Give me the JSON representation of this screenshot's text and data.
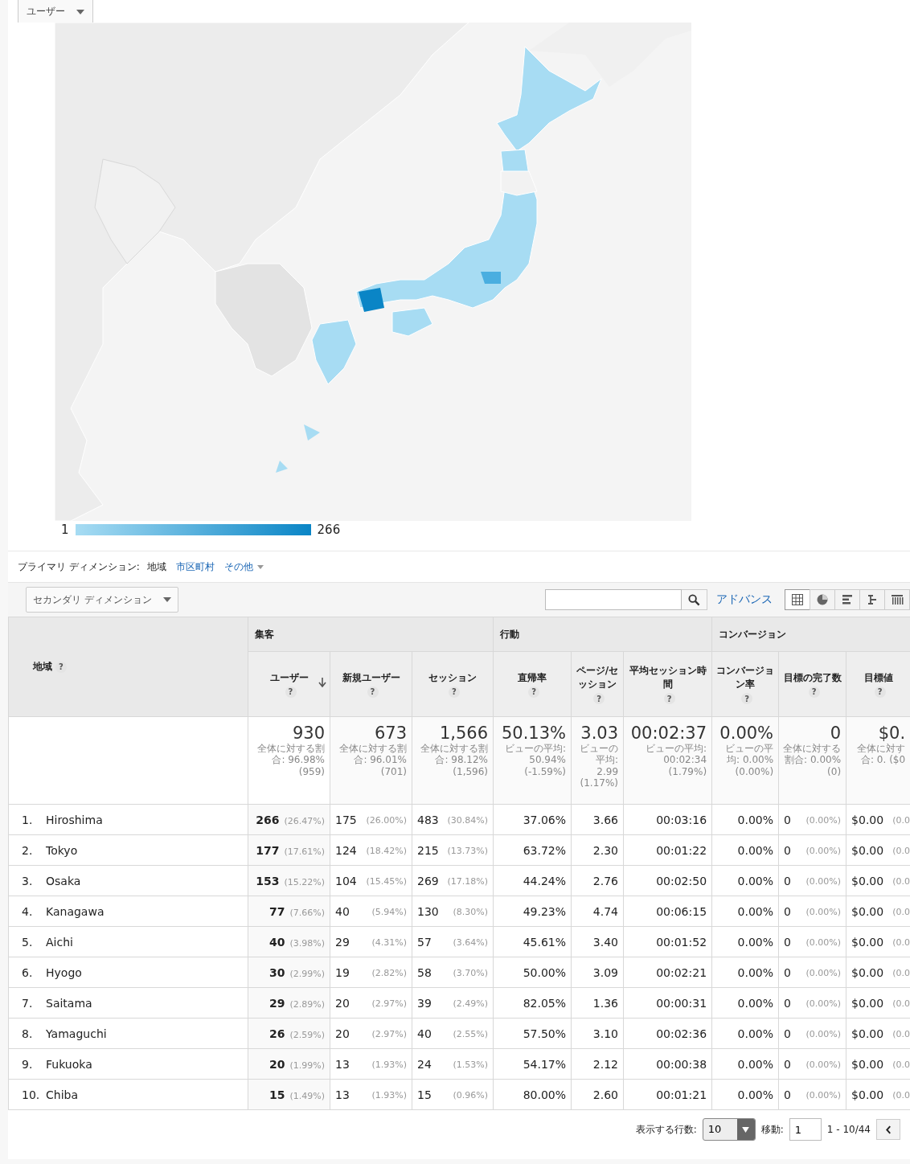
{
  "metric_selector": {
    "label": "ユーザー"
  },
  "map_legend": {
    "min": "1",
    "max": "266"
  },
  "primary_dimension": {
    "label": "プライマリ ディメンション:",
    "options": [
      {
        "label": "地域",
        "selected": true,
        "kind": "link"
      },
      {
        "label": "市区町村",
        "selected": false,
        "kind": "link"
      },
      {
        "label": "その他",
        "selected": false,
        "kind": "menu"
      }
    ]
  },
  "secondary_dimension": {
    "label": "セカンダリ ディメンション"
  },
  "advanced_link": "アドバンス",
  "views": [
    {
      "kind": "table",
      "selected": true
    },
    {
      "kind": "pie",
      "selected": false
    },
    {
      "kind": "bars",
      "selected": false
    },
    {
      "kind": "compare",
      "selected": false
    },
    {
      "kind": "pivot",
      "selected": false
    }
  ],
  "table": {
    "dimension_column": {
      "label": "地域",
      "help": "?"
    },
    "groups": [
      {
        "label": "集客",
        "columns": [
          {
            "label": "ユーザー",
            "help": "?",
            "sorted": true
          },
          {
            "label": "新規ユーザー",
            "help": "?",
            "sorted": false
          },
          {
            "label": "セッション",
            "help": "?",
            "sorted": false
          }
        ]
      },
      {
        "label": "行動",
        "columns": [
          {
            "label": "直帰率",
            "help": "?",
            "sorted": false
          },
          {
            "label": "ページ/セッション",
            "help": "?",
            "sorted": false
          },
          {
            "label": "平均セッション時間",
            "help": "?",
            "sorted": false
          }
        ]
      },
      {
        "label": "コンバージョン",
        "columns": [
          {
            "label": "コンバージョン率",
            "help": "?",
            "sorted": false
          },
          {
            "label": "目標の完了数",
            "help": "?",
            "sorted": false
          },
          {
            "label": "目標値",
            "help": "?",
            "sorted": false
          }
        ]
      }
    ],
    "totals": [
      {
        "value": "930",
        "note": "全体に対する割合: 96.98% (959)"
      },
      {
        "value": "673",
        "note": "全体に対する割合: 96.01% (701)"
      },
      {
        "value": "1,566",
        "note": "全体に対する割合: 98.12% (1,596)"
      },
      {
        "value": "50.13%",
        "note": "ビューの平均: 50.94% (-1.59%)"
      },
      {
        "value": "3.03",
        "note": "ビューの平均: 2.99 (1.17%)"
      },
      {
        "value": "00:02:37",
        "note": "ビューの平均: 00:02:34 (1.79%)"
      },
      {
        "value": "0.00%",
        "note": "ビューの平均: 0.00% (0.00%)"
      },
      {
        "value": "0",
        "note": "全体に対する割合: 0.00% (0)"
      },
      {
        "value": "$0.",
        "note": "全体に対す合: 0. ($0"
      }
    ],
    "rows": [
      {
        "rank": "1.",
        "name": "Hiroshima",
        "cells": [
          {
            "value": "266",
            "pct": "(26.47%)"
          },
          {
            "value": "175",
            "pct": "(26.00%)"
          },
          {
            "value": "483",
            "pct": "(30.84%)"
          },
          {
            "value": "37.06%"
          },
          {
            "value": "3.66"
          },
          {
            "value": "00:03:16"
          },
          {
            "value": "0.00%"
          },
          {
            "value": "0",
            "pct": "(0.00%)"
          },
          {
            "value": "$0.00",
            "pct": "(0.0"
          }
        ]
      },
      {
        "rank": "2.",
        "name": "Tokyo",
        "cells": [
          {
            "value": "177",
            "pct": "(17.61%)"
          },
          {
            "value": "124",
            "pct": "(18.42%)"
          },
          {
            "value": "215",
            "pct": "(13.73%)"
          },
          {
            "value": "63.72%"
          },
          {
            "value": "2.30"
          },
          {
            "value": "00:01:22"
          },
          {
            "value": "0.00%"
          },
          {
            "value": "0",
            "pct": "(0.00%)"
          },
          {
            "value": "$0.00",
            "pct": "(0.0"
          }
        ]
      },
      {
        "rank": "3.",
        "name": "Osaka",
        "cells": [
          {
            "value": "153",
            "pct": "(15.22%)"
          },
          {
            "value": "104",
            "pct": "(15.45%)"
          },
          {
            "value": "269",
            "pct": "(17.18%)"
          },
          {
            "value": "44.24%"
          },
          {
            "value": "2.76"
          },
          {
            "value": "00:02:50"
          },
          {
            "value": "0.00%"
          },
          {
            "value": "0",
            "pct": "(0.00%)"
          },
          {
            "value": "$0.00",
            "pct": "(0.0"
          }
        ]
      },
      {
        "rank": "4.",
        "name": "Kanagawa",
        "cells": [
          {
            "value": "77",
            "pct": "(7.66%)"
          },
          {
            "value": "40",
            "pct": "(5.94%)"
          },
          {
            "value": "130",
            "pct": "(8.30%)"
          },
          {
            "value": "49.23%"
          },
          {
            "value": "4.74"
          },
          {
            "value": "00:06:15"
          },
          {
            "value": "0.00%"
          },
          {
            "value": "0",
            "pct": "(0.00%)"
          },
          {
            "value": "$0.00",
            "pct": "(0.0"
          }
        ]
      },
      {
        "rank": "5.",
        "name": "Aichi",
        "cells": [
          {
            "value": "40",
            "pct": "(3.98%)"
          },
          {
            "value": "29",
            "pct": "(4.31%)"
          },
          {
            "value": "57",
            "pct": "(3.64%)"
          },
          {
            "value": "45.61%"
          },
          {
            "value": "3.40"
          },
          {
            "value": "00:01:52"
          },
          {
            "value": "0.00%"
          },
          {
            "value": "0",
            "pct": "(0.00%)"
          },
          {
            "value": "$0.00",
            "pct": "(0.0"
          }
        ]
      },
      {
        "rank": "6.",
        "name": "Hyogo",
        "cells": [
          {
            "value": "30",
            "pct": "(2.99%)"
          },
          {
            "value": "19",
            "pct": "(2.82%)"
          },
          {
            "value": "58",
            "pct": "(3.70%)"
          },
          {
            "value": "50.00%"
          },
          {
            "value": "3.09"
          },
          {
            "value": "00:02:21"
          },
          {
            "value": "0.00%"
          },
          {
            "value": "0",
            "pct": "(0.00%)"
          },
          {
            "value": "$0.00",
            "pct": "(0.0"
          }
        ]
      },
      {
        "rank": "7.",
        "name": "Saitama",
        "cells": [
          {
            "value": "29",
            "pct": "(2.89%)"
          },
          {
            "value": "20",
            "pct": "(2.97%)"
          },
          {
            "value": "39",
            "pct": "(2.49%)"
          },
          {
            "value": "82.05%"
          },
          {
            "value": "1.36"
          },
          {
            "value": "00:00:31"
          },
          {
            "value": "0.00%"
          },
          {
            "value": "0",
            "pct": "(0.00%)"
          },
          {
            "value": "$0.00",
            "pct": "(0.0"
          }
        ]
      },
      {
        "rank": "8.",
        "name": "Yamaguchi",
        "cells": [
          {
            "value": "26",
            "pct": "(2.59%)"
          },
          {
            "value": "20",
            "pct": "(2.97%)"
          },
          {
            "value": "40",
            "pct": "(2.55%)"
          },
          {
            "value": "57.50%"
          },
          {
            "value": "3.10"
          },
          {
            "value": "00:02:36"
          },
          {
            "value": "0.00%"
          },
          {
            "value": "0",
            "pct": "(0.00%)"
          },
          {
            "value": "$0.00",
            "pct": "(0.0"
          }
        ]
      },
      {
        "rank": "9.",
        "name": "Fukuoka",
        "cells": [
          {
            "value": "20",
            "pct": "(1.99%)"
          },
          {
            "value": "13",
            "pct": "(1.93%)"
          },
          {
            "value": "24",
            "pct": "(1.53%)"
          },
          {
            "value": "54.17%"
          },
          {
            "value": "2.12"
          },
          {
            "value": "00:00:38"
          },
          {
            "value": "0.00%"
          },
          {
            "value": "0",
            "pct": "(0.00%)"
          },
          {
            "value": "$0.00",
            "pct": "(0.0"
          }
        ]
      },
      {
        "rank": "10.",
        "name": "Chiba",
        "cells": [
          {
            "value": "15",
            "pct": "(1.49%)"
          },
          {
            "value": "13",
            "pct": "(1.93%)"
          },
          {
            "value": "15",
            "pct": "(0.96%)"
          },
          {
            "value": "80.00%"
          },
          {
            "value": "2.60"
          },
          {
            "value": "00:01:21"
          },
          {
            "value": "0.00%"
          },
          {
            "value": "0",
            "pct": "(0.00%)"
          },
          {
            "value": "$0.00",
            "pct": "(0.0"
          }
        ]
      }
    ]
  },
  "pagination": {
    "rows_label": "表示する行数:",
    "rows_value": "10",
    "goto_label": "移動:",
    "goto_value": "1",
    "range": "1 - 10/44"
  }
}
